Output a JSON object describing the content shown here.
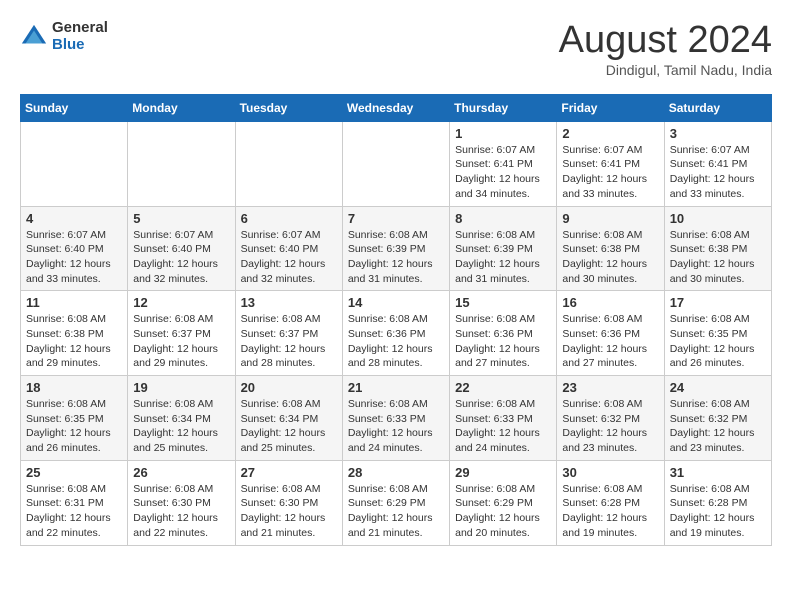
{
  "header": {
    "logo_general": "General",
    "logo_blue": "Blue",
    "month_title": "August 2024",
    "location": "Dindigul, Tamil Nadu, India"
  },
  "calendar": {
    "days_of_week": [
      "Sunday",
      "Monday",
      "Tuesday",
      "Wednesday",
      "Thursday",
      "Friday",
      "Saturday"
    ],
    "weeks": [
      [
        {
          "day": "",
          "info": ""
        },
        {
          "day": "",
          "info": ""
        },
        {
          "day": "",
          "info": ""
        },
        {
          "day": "",
          "info": ""
        },
        {
          "day": "1",
          "info": "Sunrise: 6:07 AM\nSunset: 6:41 PM\nDaylight: 12 hours\nand 34 minutes."
        },
        {
          "day": "2",
          "info": "Sunrise: 6:07 AM\nSunset: 6:41 PM\nDaylight: 12 hours\nand 33 minutes."
        },
        {
          "day": "3",
          "info": "Sunrise: 6:07 AM\nSunset: 6:41 PM\nDaylight: 12 hours\nand 33 minutes."
        }
      ],
      [
        {
          "day": "4",
          "info": "Sunrise: 6:07 AM\nSunset: 6:40 PM\nDaylight: 12 hours\nand 33 minutes."
        },
        {
          "day": "5",
          "info": "Sunrise: 6:07 AM\nSunset: 6:40 PM\nDaylight: 12 hours\nand 32 minutes."
        },
        {
          "day": "6",
          "info": "Sunrise: 6:07 AM\nSunset: 6:40 PM\nDaylight: 12 hours\nand 32 minutes."
        },
        {
          "day": "7",
          "info": "Sunrise: 6:08 AM\nSunset: 6:39 PM\nDaylight: 12 hours\nand 31 minutes."
        },
        {
          "day": "8",
          "info": "Sunrise: 6:08 AM\nSunset: 6:39 PM\nDaylight: 12 hours\nand 31 minutes."
        },
        {
          "day": "9",
          "info": "Sunrise: 6:08 AM\nSunset: 6:38 PM\nDaylight: 12 hours\nand 30 minutes."
        },
        {
          "day": "10",
          "info": "Sunrise: 6:08 AM\nSunset: 6:38 PM\nDaylight: 12 hours\nand 30 minutes."
        }
      ],
      [
        {
          "day": "11",
          "info": "Sunrise: 6:08 AM\nSunset: 6:38 PM\nDaylight: 12 hours\nand 29 minutes."
        },
        {
          "day": "12",
          "info": "Sunrise: 6:08 AM\nSunset: 6:37 PM\nDaylight: 12 hours\nand 29 minutes."
        },
        {
          "day": "13",
          "info": "Sunrise: 6:08 AM\nSunset: 6:37 PM\nDaylight: 12 hours\nand 28 minutes."
        },
        {
          "day": "14",
          "info": "Sunrise: 6:08 AM\nSunset: 6:36 PM\nDaylight: 12 hours\nand 28 minutes."
        },
        {
          "day": "15",
          "info": "Sunrise: 6:08 AM\nSunset: 6:36 PM\nDaylight: 12 hours\nand 27 minutes."
        },
        {
          "day": "16",
          "info": "Sunrise: 6:08 AM\nSunset: 6:36 PM\nDaylight: 12 hours\nand 27 minutes."
        },
        {
          "day": "17",
          "info": "Sunrise: 6:08 AM\nSunset: 6:35 PM\nDaylight: 12 hours\nand 26 minutes."
        }
      ],
      [
        {
          "day": "18",
          "info": "Sunrise: 6:08 AM\nSunset: 6:35 PM\nDaylight: 12 hours\nand 26 minutes."
        },
        {
          "day": "19",
          "info": "Sunrise: 6:08 AM\nSunset: 6:34 PM\nDaylight: 12 hours\nand 25 minutes."
        },
        {
          "day": "20",
          "info": "Sunrise: 6:08 AM\nSunset: 6:34 PM\nDaylight: 12 hours\nand 25 minutes."
        },
        {
          "day": "21",
          "info": "Sunrise: 6:08 AM\nSunset: 6:33 PM\nDaylight: 12 hours\nand 24 minutes."
        },
        {
          "day": "22",
          "info": "Sunrise: 6:08 AM\nSunset: 6:33 PM\nDaylight: 12 hours\nand 24 minutes."
        },
        {
          "day": "23",
          "info": "Sunrise: 6:08 AM\nSunset: 6:32 PM\nDaylight: 12 hours\nand 23 minutes."
        },
        {
          "day": "24",
          "info": "Sunrise: 6:08 AM\nSunset: 6:32 PM\nDaylight: 12 hours\nand 23 minutes."
        }
      ],
      [
        {
          "day": "25",
          "info": "Sunrise: 6:08 AM\nSunset: 6:31 PM\nDaylight: 12 hours\nand 22 minutes."
        },
        {
          "day": "26",
          "info": "Sunrise: 6:08 AM\nSunset: 6:30 PM\nDaylight: 12 hours\nand 22 minutes."
        },
        {
          "day": "27",
          "info": "Sunrise: 6:08 AM\nSunset: 6:30 PM\nDaylight: 12 hours\nand 21 minutes."
        },
        {
          "day": "28",
          "info": "Sunrise: 6:08 AM\nSunset: 6:29 PM\nDaylight: 12 hours\nand 21 minutes."
        },
        {
          "day": "29",
          "info": "Sunrise: 6:08 AM\nSunset: 6:29 PM\nDaylight: 12 hours\nand 20 minutes."
        },
        {
          "day": "30",
          "info": "Sunrise: 6:08 AM\nSunset: 6:28 PM\nDaylight: 12 hours\nand 19 minutes."
        },
        {
          "day": "31",
          "info": "Sunrise: 6:08 AM\nSunset: 6:28 PM\nDaylight: 12 hours\nand 19 minutes."
        }
      ]
    ]
  }
}
